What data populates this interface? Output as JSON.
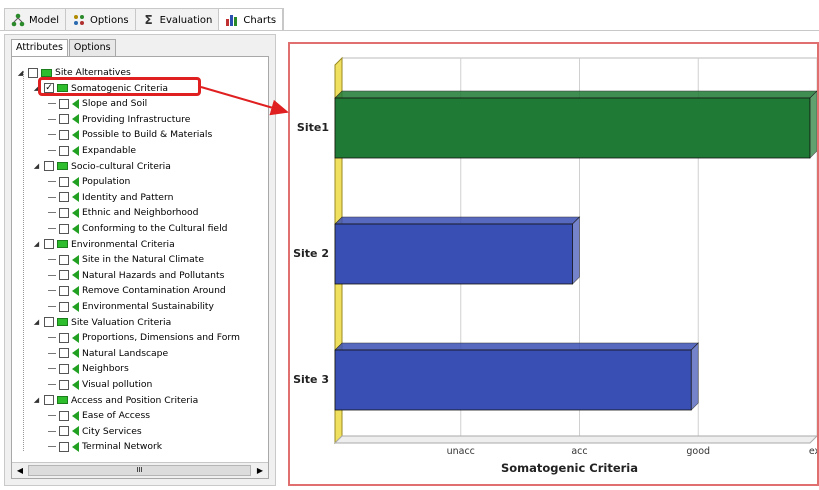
{
  "tabs": [
    {
      "label": "Model",
      "icon": "model-icon"
    },
    {
      "label": "Options",
      "icon": "options-icon"
    },
    {
      "label": "Evaluation",
      "icon": "sigma-icon"
    },
    {
      "label": "Charts",
      "icon": "chart-icon"
    }
  ],
  "subtabs": [
    "Attributes",
    "Options"
  ],
  "tree": [
    {
      "label": "Site Alternatives",
      "level": 0,
      "type": "group",
      "checked": false
    },
    {
      "label": "Somatogenic Criteria",
      "level": 1,
      "type": "group",
      "checked": true
    },
    {
      "label": "Slope and Soil",
      "level": 2,
      "type": "leaf",
      "checked": false
    },
    {
      "label": "Providing Infrastructure",
      "level": 2,
      "type": "leaf",
      "checked": false
    },
    {
      "label": "Possible to Build & Materials",
      "level": 2,
      "type": "leaf",
      "checked": false
    },
    {
      "label": "Expandable",
      "level": 2,
      "type": "leaf",
      "checked": false
    },
    {
      "label": "Socio-cultural Criteria",
      "level": 1,
      "type": "group",
      "checked": false
    },
    {
      "label": "Population",
      "level": 2,
      "type": "leaf",
      "checked": false
    },
    {
      "label": "Identity and Pattern",
      "level": 2,
      "type": "leaf",
      "checked": false
    },
    {
      "label": "Ethnic and Neighborhood",
      "level": 2,
      "type": "leaf",
      "checked": false
    },
    {
      "label": "Conforming to the Cultural field",
      "level": 2,
      "type": "leaf",
      "checked": false
    },
    {
      "label": "Environmental Criteria",
      "level": 1,
      "type": "group",
      "checked": false
    },
    {
      "label": "Site in the Natural Climate",
      "level": 2,
      "type": "leaf",
      "checked": false
    },
    {
      "label": "Natural Hazards and Pollutants",
      "level": 2,
      "type": "leaf",
      "checked": false
    },
    {
      "label": "Remove Contamination Around",
      "level": 2,
      "type": "leaf",
      "checked": false
    },
    {
      "label": "Environmental Sustainability",
      "level": 2,
      "type": "leaf",
      "checked": false
    },
    {
      "label": "Site Valuation Criteria",
      "level": 1,
      "type": "group",
      "checked": false
    },
    {
      "label": "Proportions, Dimensions and Form",
      "level": 2,
      "type": "leaf",
      "checked": false
    },
    {
      "label": "Natural Landscape",
      "level": 2,
      "type": "leaf",
      "checked": false
    },
    {
      "label": "Neighbors",
      "level": 2,
      "type": "leaf",
      "checked": false
    },
    {
      "label": "Visual pollution",
      "level": 2,
      "type": "leaf",
      "checked": false
    },
    {
      "label": "Access and Position Criteria",
      "level": 1,
      "type": "group",
      "checked": false
    },
    {
      "label": "Ease of Access",
      "level": 2,
      "type": "leaf",
      "checked": false
    },
    {
      "label": "City Services",
      "level": 2,
      "type": "leaf",
      "checked": false
    },
    {
      "label": "Terminal Network",
      "level": 2,
      "type": "leaf",
      "checked": false
    }
  ],
  "scrollbar": {
    "thumb_label": "III",
    "left_arrow": "◀",
    "right_arrow": "▶"
  },
  "colors": {
    "highlight": "#e02020",
    "green_bar": "#1f7a35",
    "blue_bar": "#3a4fb4",
    "axis_wall": "#f0e060",
    "panel_border": "#e07070"
  },
  "chart_data": {
    "type": "bar",
    "orientation": "horizontal",
    "title": "",
    "xlabel": "Somatogenic Criteria",
    "ylabel": "",
    "categories": [
      "Site1",
      "Site 2",
      "Site 3"
    ],
    "x_ticks": [
      "unacc",
      "acc",
      "good",
      "exc"
    ],
    "xlim": [
      0,
      4
    ],
    "values": [
      4.0,
      2.0,
      3.0
    ],
    "bar_colors": [
      "#1f7a35",
      "#3a4fb4",
      "#3a4fb4"
    ],
    "grid": true,
    "style": "3d"
  }
}
